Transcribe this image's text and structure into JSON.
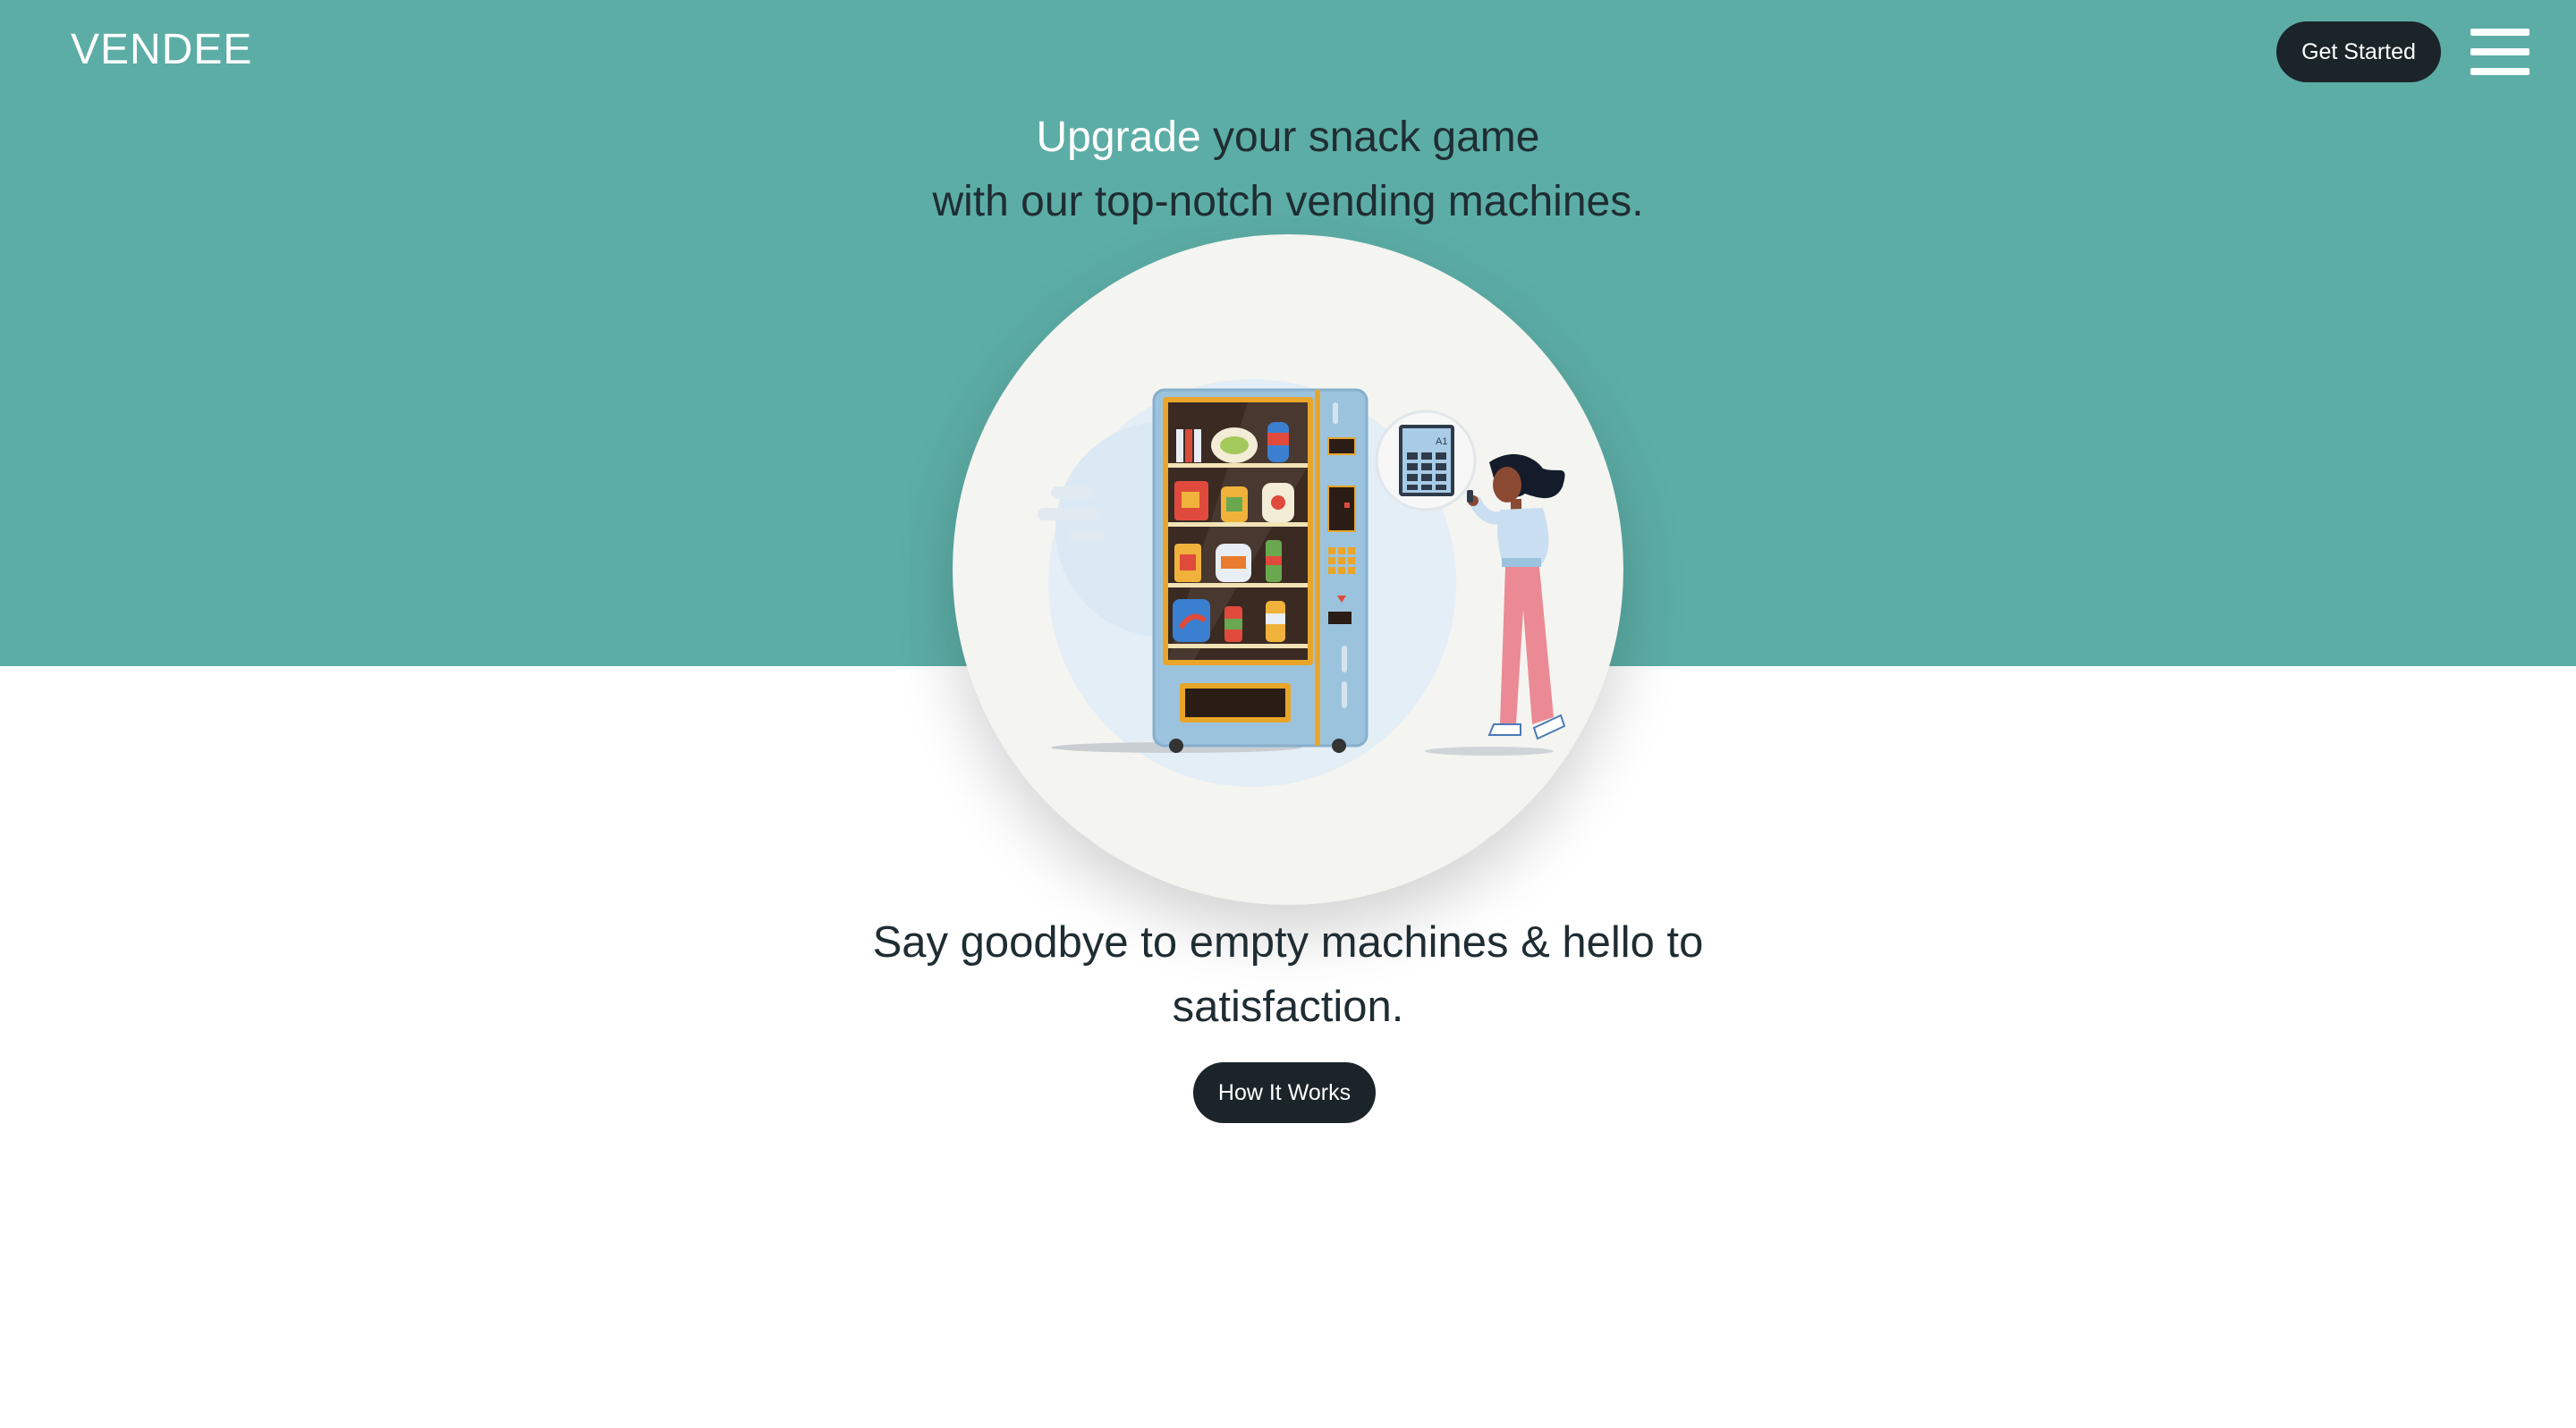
{
  "brand": {
    "logo": "VENDEE"
  },
  "nav": {
    "cta_label": "Get Started",
    "menu_icon": "hamburger-menu-icon"
  },
  "hero": {
    "headline_accent": "Upgrade",
    "headline_rest": " your snack game",
    "headline_line2": "with our top-notch vending machines.",
    "illustration_text": "A1",
    "tagline_line1": "Say goodbye to empty machines & hello to",
    "tagline_line2": "satisfaction.",
    "secondary_cta_label": "How It Works"
  },
  "colors": {
    "hero_background": "#5cada6",
    "button_dark": "#1b2428",
    "text_dark": "#1f2d33",
    "accent_text": "#ffffff"
  }
}
